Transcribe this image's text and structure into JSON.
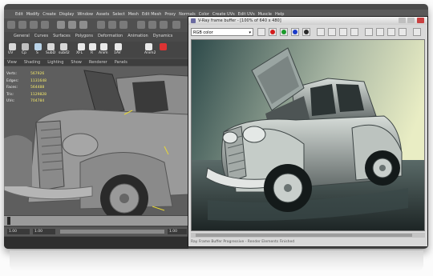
{
  "maya": {
    "menu": [
      "Edit",
      "Modify",
      "Create",
      "Display",
      "Window",
      "Assets",
      "Select",
      "Mesh",
      "Edit Mesh",
      "Proxy",
      "Normals",
      "Color",
      "Create UVs",
      "Edit UVs",
      "Muscle",
      "Help"
    ],
    "shelf_tabs": [
      "General",
      "Curves",
      "Surfaces",
      "Polygons",
      "Deformation",
      "Animation",
      "Dynamics"
    ],
    "shelf_icons": [
      "UV",
      "Cp",
      "S",
      "SubD",
      "subd2",
      "XFL",
      "R",
      "Anim",
      "1AV",
      "Anim2"
    ],
    "panel_menu": [
      "View",
      "Shading",
      "Lighting",
      "Show",
      "Renderer",
      "Panels"
    ],
    "hud": [
      {
        "label": "Verts:",
        "value": "567926"
      },
      {
        "label": "Edges:",
        "value": "1131648"
      },
      {
        "label": "Faces:",
        "value": "564488"
      },
      {
        "label": "Tris:",
        "value": "1129828"
      },
      {
        "label": "UVs:",
        "value": "704784"
      }
    ],
    "range_start": "1.00",
    "range_current": "1.00",
    "range_end": "1.00"
  },
  "vfb": {
    "title": "V-Ray frame buffer - [100% of 640 x 480]",
    "channel": "RGB color",
    "status": "Ray Frame Buffer Progressive - Render Elements Finished",
    "colors": {
      "red": "#d21a1a",
      "green": "#1a9a2a",
      "blue": "#1a3ac8"
    }
  }
}
